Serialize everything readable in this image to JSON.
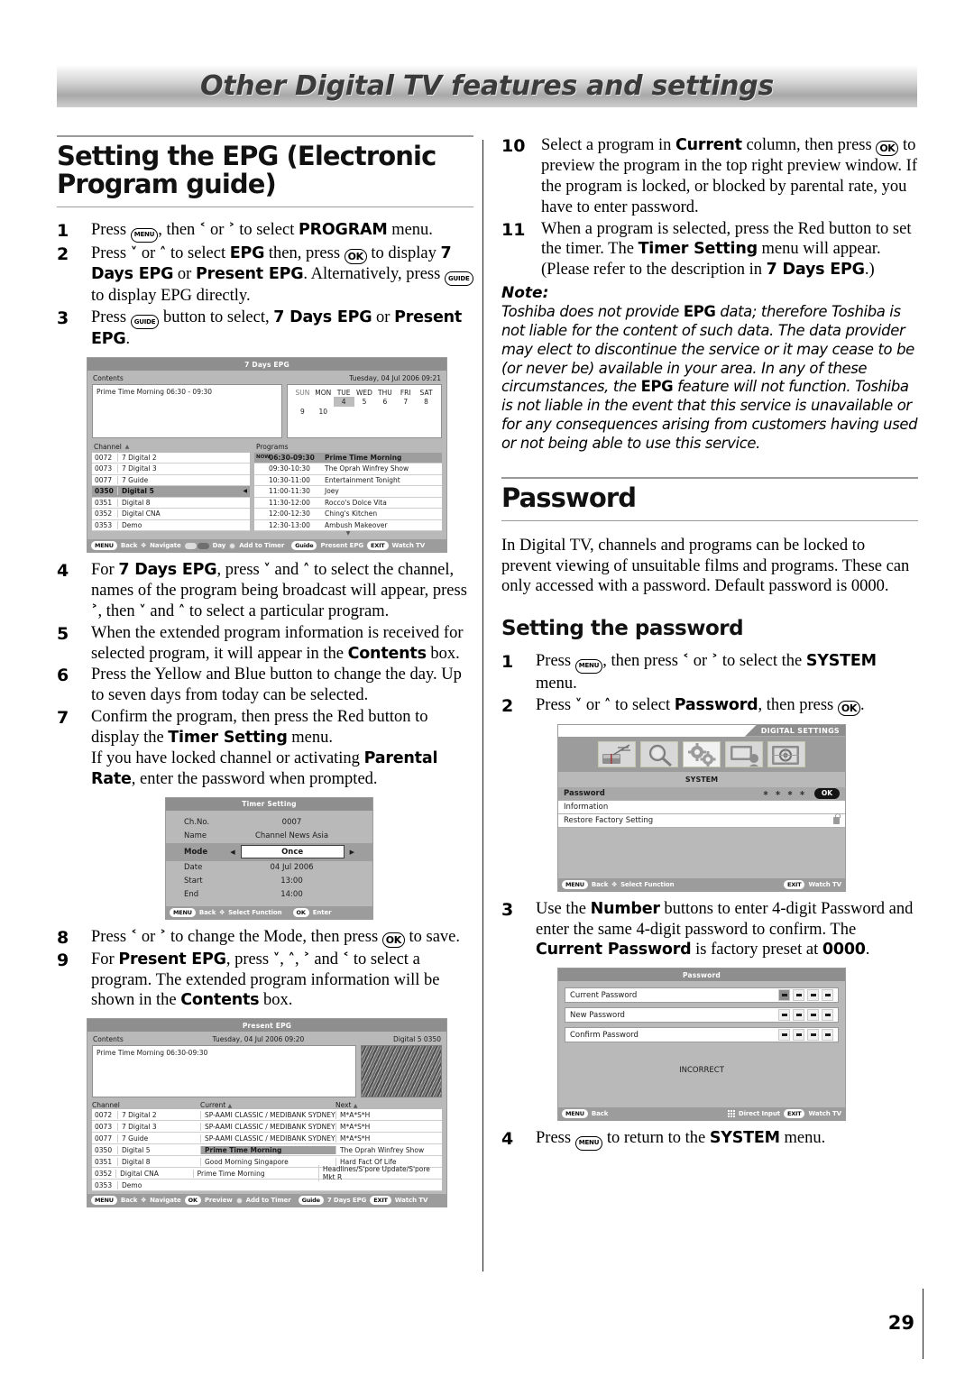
{
  "page": {
    "banner_title": "Other Digital TV features and settings",
    "number": "29"
  },
  "left_column": {
    "heading": "Setting the EPG (Electronic Program guide)",
    "steps": [
      {
        "num": "1",
        "html": "Press <span class=\"key key-menu\">MENU</span>, then <span class=\"arw\">&#706;</span> or <span class=\"arw\">&#707;</span> to select <b>PROGRAM</b> menu."
      },
      {
        "num": "2",
        "html": "Press <span class=\"arw\">&#709;</span> or <span class=\"arw\">&#708;</span> to select <b>EPG</b> then, press <span class=\"key key-ok\">OK</span> to display <b>7 Days EPG</b> or <b>Present EPG</b>. Alternatively, press <span class=\"key key-guide\">GUIDE</span> to display EPG directly."
      },
      {
        "num": "3",
        "html": "Press <span class=\"key key-guide\">GUIDE</span> button to select, <b>7 Days EPG</b> or <b>Present EPG</b>."
      },
      {
        "num": "4",
        "html": "For <b>7 Days EPG</b>, press <span class=\"arw\">&#709;</span> and <span class=\"arw\">&#708;</span> to select the channel, names of the program being broadcast will appear, press <span class=\"arw\">&#707;</span>, then <span class=\"arw\">&#709;</span> and <span class=\"arw\">&#708;</span> to select a particular program."
      },
      {
        "num": "5",
        "html": "When the extended program information is received for selected program, it will appear in the <b>Contents</b> box."
      },
      {
        "num": "6",
        "html": "Press the Yellow and Blue button to change the day. Up to seven days from today can be selected."
      },
      {
        "num": "7",
        "html": "Confirm the program, then press the Red button to display the <b>Timer Setting</b> menu.<br>If you have locked channel or activating <b>Parental Rate</b>, enter the password when prompted."
      },
      {
        "num": "8",
        "html": "Press <span class=\"arw\">&#706;</span> or <span class=\"arw\">&#707;</span> to change the Mode, then press <span class=\"key key-ok\">OK</span> to save."
      },
      {
        "num": "9",
        "html": "For <b>Present EPG</b>, press <span class=\"arw\">&#709;</span>, <span class=\"arw\">&#708;</span>, <span class=\"arw\">&#707;</span> and <span class=\"arw\">&#706;</span> to select a program. The extended program information will be shown in the <b>Contents</b> box."
      }
    ]
  },
  "right_column": {
    "steps_top": [
      {
        "num": "10",
        "html": "Select a program in <b>Current</b> column, then press <span class=\"key key-ok\">OK</span> to preview the program in the top right preview window. If the program is locked, or blocked by parental rate, you have to enter password."
      },
      {
        "num": "11",
        "html": "When a program is selected, press the Red button to set the timer. The <b>Timer Setting</b> menu will appear. (Please refer to the description in <b>7 Days EPG</b>.)"
      }
    ],
    "note_label": "Note:",
    "note_html": "Toshiba does not provide <b>EPG</b> data; therefore Toshiba is not liable for the content of such data. The data provider may elect to discontinue the service or it may cease to be (or never be) available in your area. In any of these circumstances, the <b>EPG</b> feature will not function. Toshiba is not liable in the event that this service is unavailable or for any consequences arising from customers having used or not being able to use this service.",
    "password_heading": "Password",
    "password_intro": "In Digital TV, channels and programs can be locked to prevent viewing of unsuitable films and programs. These can only accessed with a password. Default password is 0000.",
    "setting_heading": "Setting the password",
    "steps_pw": [
      {
        "num": "1",
        "html": "Press <span class=\"key key-menu\">MENU</span>, then press <span class=\"arw\">&#706;</span> or <span class=\"arw\">&#707;</span> to select the <b>SYSTEM</b> menu."
      },
      {
        "num": "2",
        "html": "Press <span class=\"arw\">&#709;</span> or <span class=\"arw\">&#708;</span> to select <b>Password</b>, then press <span class=\"key key-ok\">OK</span>."
      }
    ],
    "steps_pw_3": {
      "num": "3",
      "html": "Use the <b>Number</b> buttons to enter 4-digit Password and enter the same 4-digit password to confirm. The <b>Current Password</b> is factory preset at <b>0000</b>."
    },
    "steps_pw_4": {
      "num": "4",
      "html": "Press <span class=\"key key-menu\">MENU</span> to return to the <b>SYSTEM</b> menu."
    }
  },
  "seven_days_epg": {
    "title": "7 Days EPG",
    "contents_label": "Contents",
    "contents_text": "Prime Time Morning 06:30 - 09:30",
    "datetime": "Tuesday, 04 Jul 2006 09:21",
    "calendar": {
      "dow": [
        "SUN",
        "MON",
        "TUE",
        "WED",
        "THU",
        "FRI",
        "SAT"
      ],
      "row1": [
        "",
        "",
        "4",
        "5",
        "6",
        "7",
        "8"
      ],
      "row2": [
        "9",
        "10",
        "",
        "",
        "",
        "",
        ""
      ],
      "selected": "4"
    },
    "channel_label": "Channel",
    "programs_label": "Programs",
    "channels": [
      {
        "no": "0072",
        "name": "7 Digital 2",
        "selected": false
      },
      {
        "no": "0073",
        "name": "7 Digital 3",
        "selected": false
      },
      {
        "no": "0077",
        "name": "7 Guide",
        "selected": false
      },
      {
        "no": "0350",
        "name": "Digital 5",
        "selected": true
      },
      {
        "no": "0351",
        "name": "Digital 8",
        "selected": false
      },
      {
        "no": "0352",
        "name": "Digital CNA",
        "selected": false
      },
      {
        "no": "0353",
        "name": "Demo",
        "selected": false
      }
    ],
    "programs": [
      {
        "now": "NOW",
        "time": "06:30-09:30",
        "name": "Prime Time Morning",
        "selected": true
      },
      {
        "now": "",
        "time": "09:30-10:30",
        "name": "The Oprah Winfrey Show",
        "selected": false
      },
      {
        "now": "",
        "time": "10:30-11:00",
        "name": "Entertainment Tonight",
        "selected": false
      },
      {
        "now": "",
        "time": "11:00-11:30",
        "name": "Joey",
        "selected": false
      },
      {
        "now": "",
        "time": "11:30-12:00",
        "name": "Rocco's Dolce Vita",
        "selected": false
      },
      {
        "now": "",
        "time": "12:00-12:30",
        "name": "Ching's Kitchen",
        "selected": false
      },
      {
        "now": "",
        "time": "12:30-13:00",
        "name": "Ambush Makeover",
        "selected": false
      }
    ],
    "footer": {
      "menu": "MENU",
      "back": "Back",
      "navigate": "Navigate",
      "day": "Day",
      "add_to_timer": "Add to Timer",
      "guide": "Guide",
      "guide_action": "Present EPG",
      "exit": "EXIT",
      "exit_action": "Watch TV"
    }
  },
  "timer_setting": {
    "title": "Timer Setting",
    "rows": [
      {
        "label": "Ch.No.",
        "value": "0007",
        "selected": false
      },
      {
        "label": "Name",
        "value": "Channel News Asia",
        "selected": false
      },
      {
        "label": "Mode",
        "value": "Once",
        "selected": true
      },
      {
        "label": "Date",
        "value": "04 Jul 2006",
        "selected": false
      },
      {
        "label": "Start",
        "value": "13:00",
        "selected": false
      },
      {
        "label": "End",
        "value": "14:00",
        "selected": false
      }
    ],
    "footer": {
      "menu": "MENU",
      "back": "Back",
      "select_function": "Select Function",
      "ok": "OK",
      "enter": "Enter"
    }
  },
  "present_epg": {
    "title": "Present EPG",
    "contents_label": "Contents",
    "contents_text": "Prime Time Morning 06:30-09:30",
    "datetime": "Tuesday, 04 Jul 2006 09:20",
    "channel_id": "Digital 5 0350",
    "columns": [
      "Channel",
      "Current",
      "Next"
    ],
    "rows": [
      {
        "no": "0072",
        "name": "7 Digital 2",
        "current": "SP-AAMI CLASSIC / MEDIBANK SYDNEY",
        "next": "M*A*S*H",
        "selected": false
      },
      {
        "no": "0073",
        "name": "7 Digital 3",
        "current": "SP-AAMI CLASSIC / MEDIBANK SYDNEY",
        "next": "M*A*S*H",
        "selected": false
      },
      {
        "no": "0077",
        "name": "7 Guide",
        "current": "SP-AAMI CLASSIC / MEDIBANK SYDNEY",
        "next": "M*A*S*H",
        "selected": false
      },
      {
        "no": "0350",
        "name": "Digital 5",
        "current": "Prime Time Morning",
        "next": "The Oprah Winfrey Show",
        "selected": true
      },
      {
        "no": "0351",
        "name": "Digital 8",
        "current": "Good Morning Singapore",
        "next": "Hard Fact Of Life",
        "selected": false
      },
      {
        "no": "0352",
        "name": "Digital CNA",
        "current": "Prime Time Morning",
        "next": "Headlines/S'pore Update/S'pore Mkt R",
        "selected": false
      },
      {
        "no": "0353",
        "name": "Demo",
        "current": "",
        "next": "",
        "selected": false
      }
    ],
    "footer": {
      "menu": "MENU",
      "back": "Back",
      "navigate": "Navigate",
      "ok": "OK",
      "preview": "Preview",
      "add_to_timer": "Add to Timer",
      "guide": "Guide",
      "guide_action": "7 Days EPG",
      "exit": "EXIT",
      "exit_action": "Watch TV"
    }
  },
  "digital_settings": {
    "tab_title": "DIGITAL SETTINGS",
    "submenu": "SYSTEM",
    "icons": [
      "antenna-icon",
      "search-icon",
      "gears-icon",
      "display-icon",
      "tuning-icon"
    ],
    "rows": [
      {
        "label": "Password",
        "stars": "∗ ∗ ∗ ∗",
        "ok": "OK",
        "selected": true,
        "lock": false
      },
      {
        "label": "Information",
        "stars": "",
        "ok": "",
        "selected": false,
        "lock": false
      },
      {
        "label": "Restore Factory Setting",
        "stars": "",
        "ok": "",
        "selected": false,
        "lock": true
      }
    ],
    "footer": {
      "menu": "MENU",
      "back": "Back",
      "select_function": "Select Function",
      "exit": "EXIT",
      "exit_action": "Watch TV"
    }
  },
  "password_dialog": {
    "title": "Password",
    "rows": [
      {
        "label": "Current Password",
        "filled_first": true
      },
      {
        "label": "New Password",
        "filled_first": false
      },
      {
        "label": "Confirm Password",
        "filled_first": false
      }
    ],
    "message": "INCORRECT",
    "footer": {
      "menu": "MENU",
      "back": "Back",
      "direct_input": "Direct Input",
      "exit": "EXIT",
      "exit_action": "Watch TV"
    }
  }
}
